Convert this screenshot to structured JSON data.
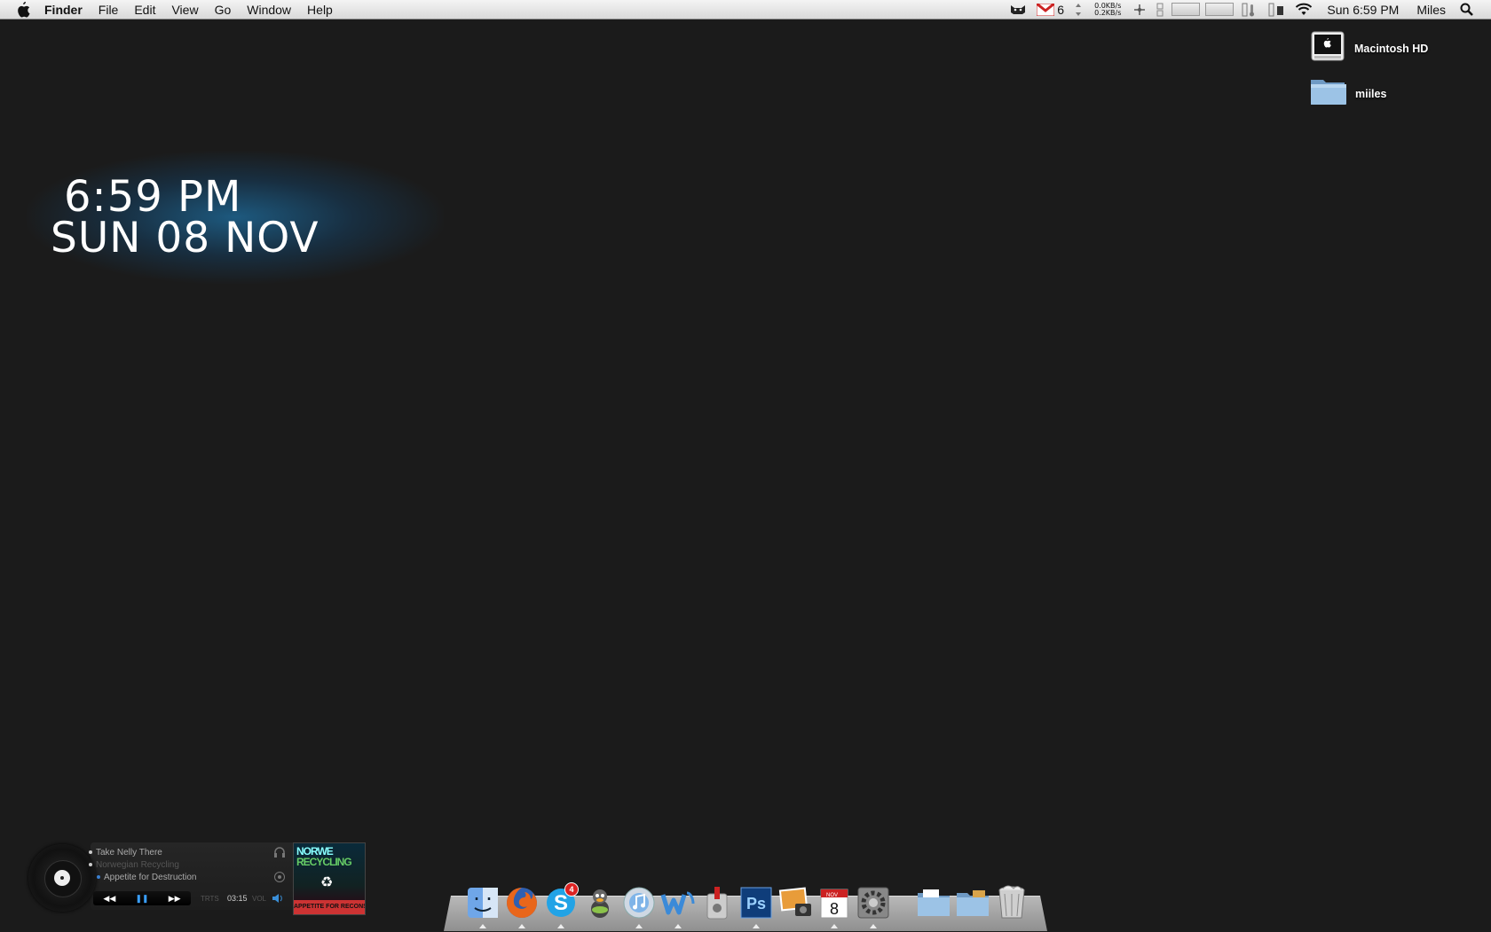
{
  "menubar": {
    "app_name": "Finder",
    "menus": [
      "File",
      "Edit",
      "View",
      "Go",
      "Window",
      "Help"
    ],
    "gmail_count": "6",
    "net_up": "0.0KB/s",
    "net_down": "0.2KB/s",
    "clock": "Sun 6:59 PM",
    "user": "Miles"
  },
  "desktop": {
    "icons": [
      {
        "label": "Macintosh HD"
      },
      {
        "label": "miiles"
      }
    ]
  },
  "clock_widget": {
    "time": "6:59 PM",
    "date": "SUN 08 NOV"
  },
  "music_widget": {
    "track": "Take Nelly There",
    "artist": "Norwegian Recycling",
    "album": "Appetite for Destruction",
    "elapsed": "03:15",
    "trts_label": "TRTS",
    "vol_label": "VOL",
    "album_art_line1": "NORWE",
    "album_art_line2": "RECYCLING",
    "album_art_bottom": "APPETITE FOR RECONSTRUCTION"
  },
  "dock": {
    "apps": [
      {
        "name": "Finder"
      },
      {
        "name": "Firefox"
      },
      {
        "name": "Skype",
        "badge": "4"
      },
      {
        "name": "Adium"
      },
      {
        "name": "iTunes"
      },
      {
        "name": "Word"
      },
      {
        "name": "Transmission"
      },
      {
        "name": "Photoshop"
      },
      {
        "name": "iPhoto"
      },
      {
        "name": "iCal"
      },
      {
        "name": "System Preferences"
      }
    ],
    "stacks": [
      {
        "name": "Documents"
      },
      {
        "name": "Downloads"
      },
      {
        "name": "Trash"
      }
    ],
    "ical_day": "8",
    "ical_month": "NOV",
    "photoshop_label": "Ps"
  },
  "colors": {
    "desktop_bg": "#1b1b1b",
    "clock_glow": "#1e6ea0",
    "accent_blue": "#3aa0ff"
  }
}
